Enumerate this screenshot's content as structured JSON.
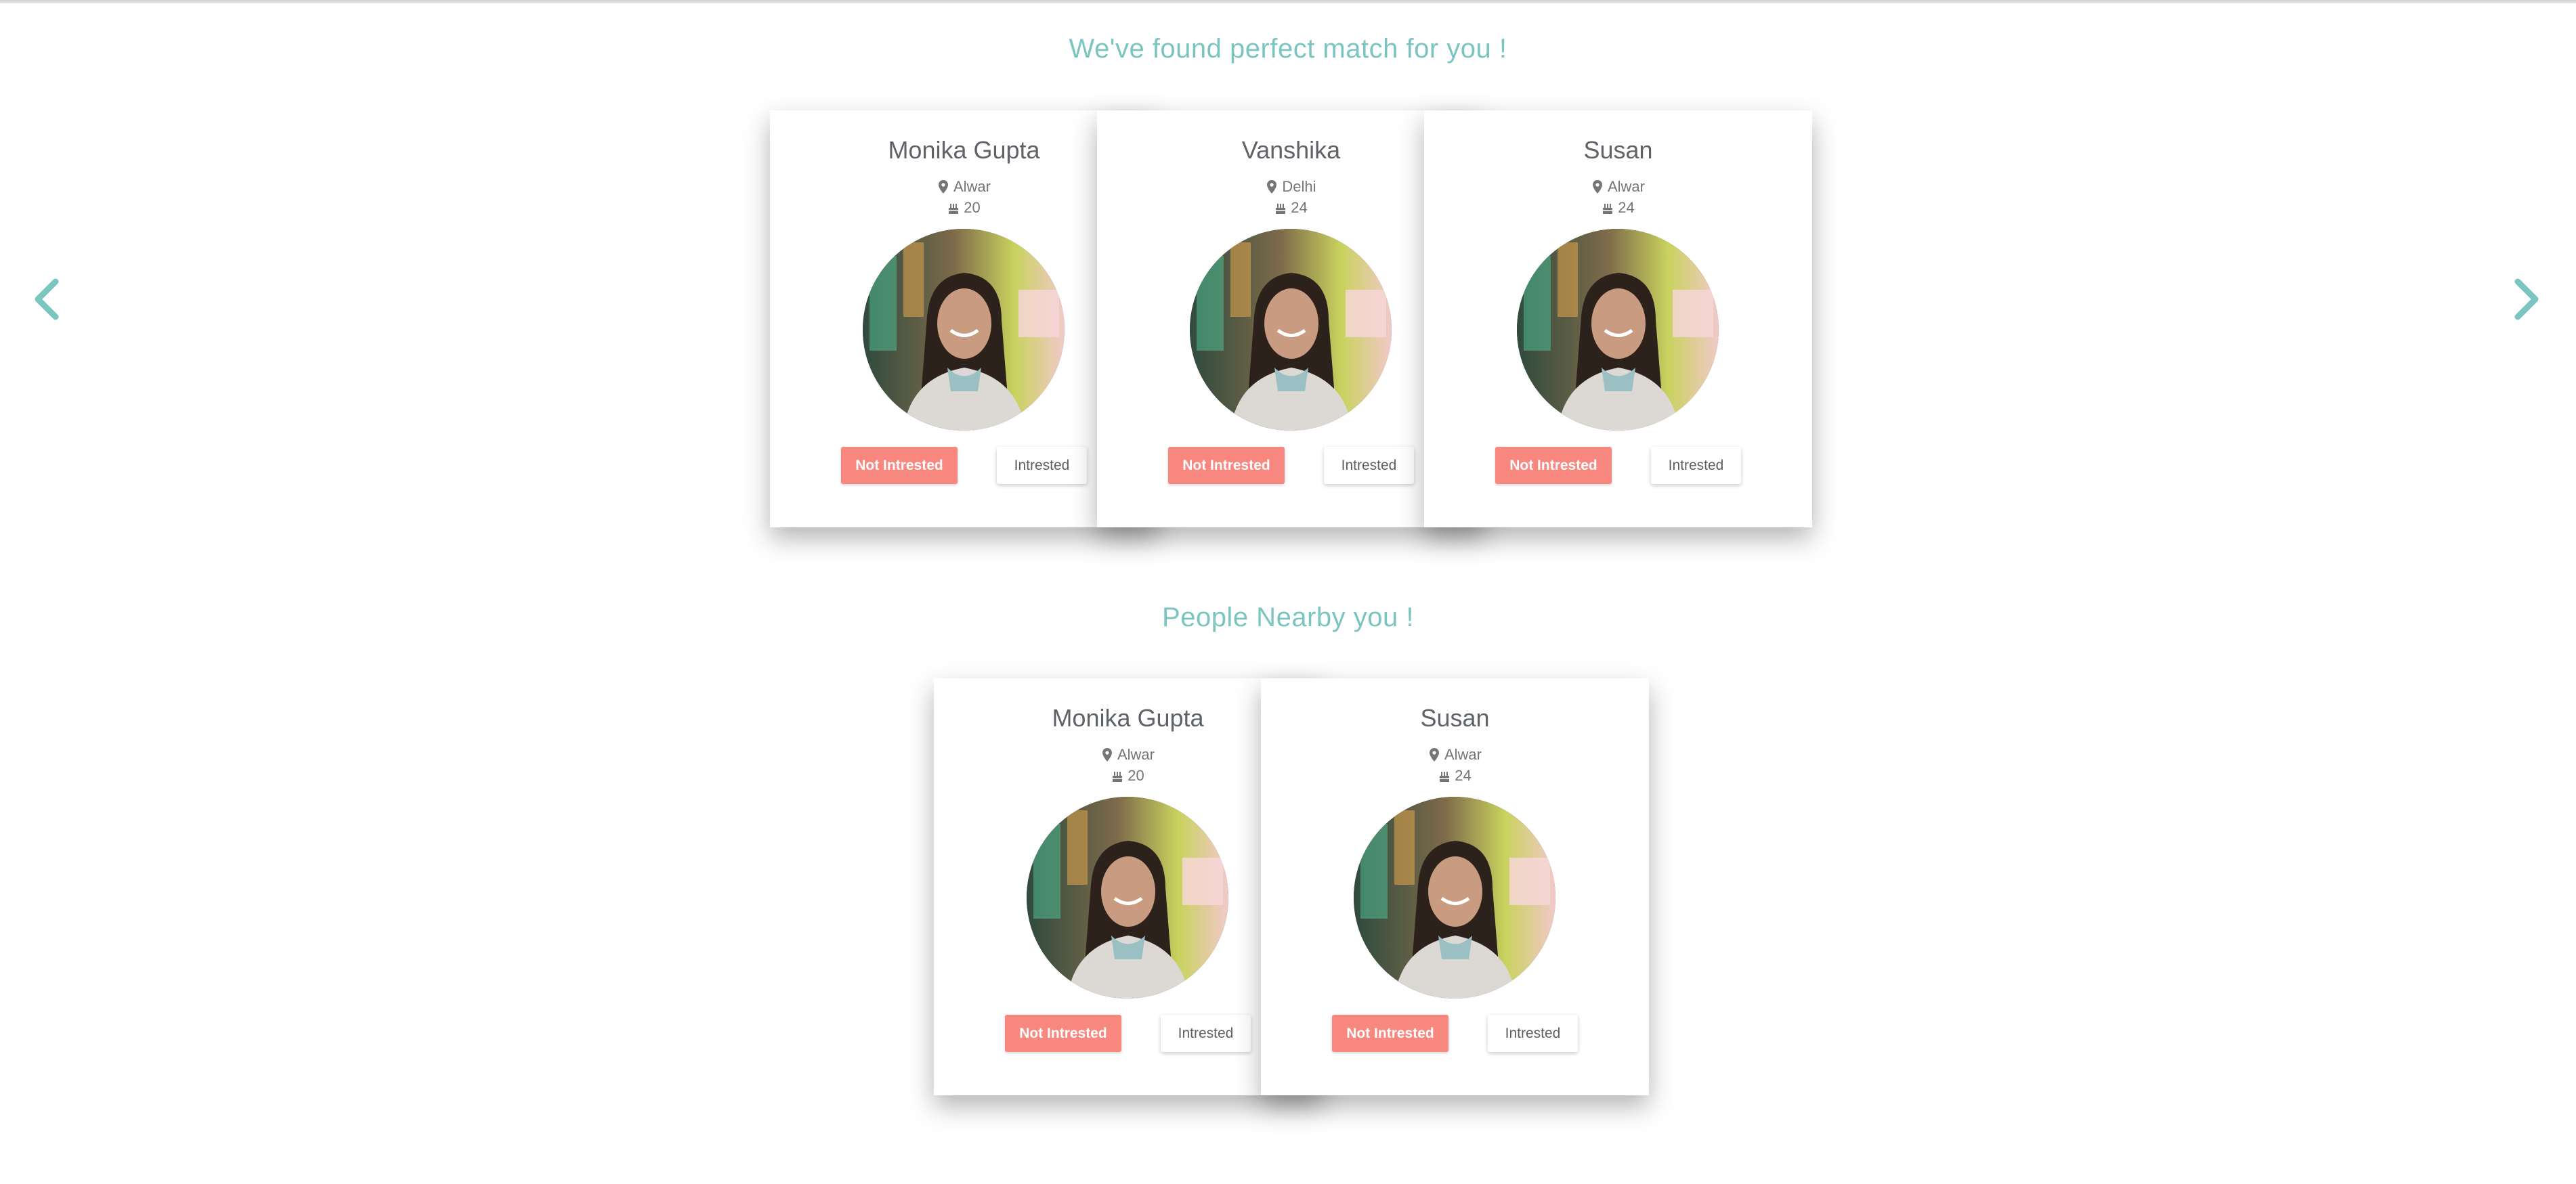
{
  "sections": {
    "matches": {
      "title": "We've found perfect match for you !",
      "cards": [
        {
          "name": "Monika Gupta",
          "location": "Alwar",
          "age": "20",
          "not_interested_label": "Not Intrested",
          "interested_label": "Intrested"
        },
        {
          "name": "Vanshika",
          "location": "Delhi",
          "age": "24",
          "not_interested_label": "Not Intrested",
          "interested_label": "Intrested"
        },
        {
          "name": "Susan",
          "location": "Alwar",
          "age": "24",
          "not_interested_label": "Not Intrested",
          "interested_label": "Intrested"
        }
      ]
    },
    "nearby": {
      "title": "People Nearby you !",
      "cards": [
        {
          "name": "Monika Gupta",
          "location": "Alwar",
          "age": "20",
          "not_interested_label": "Not Intrested",
          "interested_label": "Intrested"
        },
        {
          "name": "Susan",
          "location": "Alwar",
          "age": "24",
          "not_interested_label": "Not Intrested",
          "interested_label": "Intrested"
        }
      ]
    }
  },
  "navigation": {
    "prev_icon": "chevron-left-icon",
    "next_icon": "chevron-right-icon"
  },
  "icons": {
    "location": "map-marker-icon",
    "age": "birthday-cake-icon"
  },
  "colors": {
    "accent": "#7bc5c1",
    "not_interested": "#f7877f",
    "name_text": "#5f6368",
    "meta_text": "#757575"
  }
}
